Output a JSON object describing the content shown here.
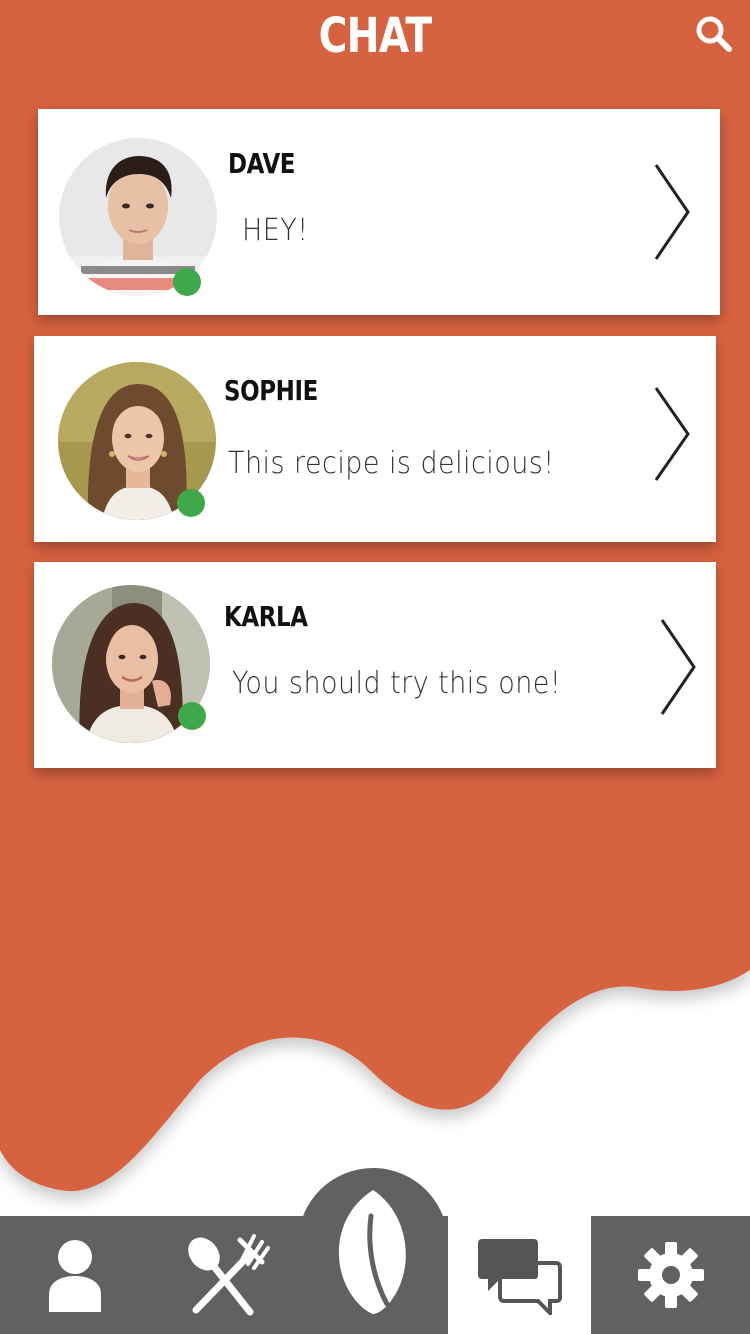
{
  "header": {
    "title": "CHAT",
    "search_icon": "search-icon"
  },
  "colors": {
    "primary": "#D76240",
    "nav": "#616161",
    "online": "#3EA84A",
    "card": "#FFFFFF"
  },
  "chats": [
    {
      "name": "DAVE",
      "message": "HEY!",
      "online": true
    },
    {
      "name": "SOPHIE",
      "message": "This recipe is delicious!",
      "online": true
    },
    {
      "name": "KARLA",
      "message": "You should try this one!",
      "online": true
    }
  ],
  "nav": {
    "items": [
      {
        "icon": "user-icon",
        "active": false
      },
      {
        "icon": "utensils-icon",
        "active": false
      },
      {
        "icon": "leaf-icon",
        "active": false
      },
      {
        "icon": "chat-bubbles-icon",
        "active": true
      },
      {
        "icon": "gear-icon",
        "active": false
      }
    ]
  }
}
